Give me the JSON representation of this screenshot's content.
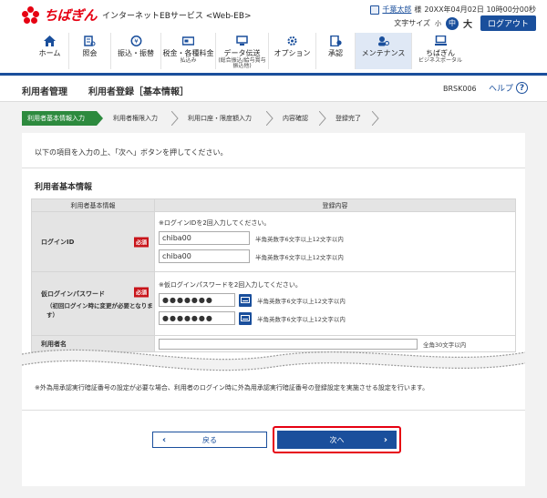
{
  "header": {
    "brand": "ちばぎん",
    "service": "インターネットEBサービス <Web-EB>",
    "user_name": "千葉太郎",
    "user_suffix": "様",
    "datetime": "20XX年04月02日 10時00分00秒",
    "font_size_label": "文字サイズ",
    "font_small": "小",
    "font_mid": "中",
    "font_large": "大",
    "logout": "ログアウト"
  },
  "nav": [
    {
      "label": "ホーム",
      "sub": "",
      "icon": "home-icon"
    },
    {
      "label": "照会",
      "sub": "",
      "icon": "inquiry-icon"
    },
    {
      "label": "振込・振替",
      "sub": "",
      "icon": "transfer-icon"
    },
    {
      "label": "税金・各種料金",
      "sub": "払込み",
      "icon": "tax-payment-icon"
    },
    {
      "label": "データ伝送",
      "sub": "(総合振込/給与賞与振込他)",
      "icon": "data-transmission-icon"
    },
    {
      "label": "オプション",
      "sub": "",
      "icon": "option-icon"
    },
    {
      "label": "承認",
      "sub": "",
      "icon": "approval-icon"
    },
    {
      "label": "メンテナンス",
      "sub": "",
      "icon": "maintenance-icon"
    },
    {
      "label": "ちばぎん",
      "sub": "ビジネスポータル",
      "icon": "business-portal-icon"
    }
  ],
  "titlebar": {
    "section": "利用者管理",
    "page": "利用者登録［基本情報］",
    "screen_id": "BRSK006",
    "help": "ヘルプ"
  },
  "steps": [
    "利用者基本情報入力",
    "利用者権限入力",
    "利用口座・限度額入力",
    "内容確認",
    "登録完了"
  ],
  "intro": "以下の項目を入力の上、「次へ」ボタンを押してください。",
  "section_title": "利用者基本情報",
  "table": {
    "col1": "利用者基本情報",
    "col2": "登録内容",
    "required": "必須",
    "login_id": {
      "label": "ログインID",
      "note": "※ログインIDを2回入力してください。",
      "value1": "chiba00",
      "value2": "chiba00",
      "hint": "半角英数字6文字以上12文字以内"
    },
    "password": {
      "label": "仮ログインパスワード",
      "sublabel": "（初回ログイン時に変更が必要となります）",
      "note": "※仮ログインパスワードを2回入力してください。",
      "value1": "●●●●●●●",
      "value2": "●●●●●●●",
      "hint": "半角英数字6文字以上12文字以内"
    },
    "user_name": {
      "label": "利用者名",
      "hint": "全角30文字以内"
    }
  },
  "note": "※外為用承認実行暗証番号の設定が必要な場合、利用者のログイン時に外為用承認実行暗証番号の登録設定を実施させる設定を行います。",
  "buttons": {
    "back": "戻る",
    "next": "次へ"
  }
}
